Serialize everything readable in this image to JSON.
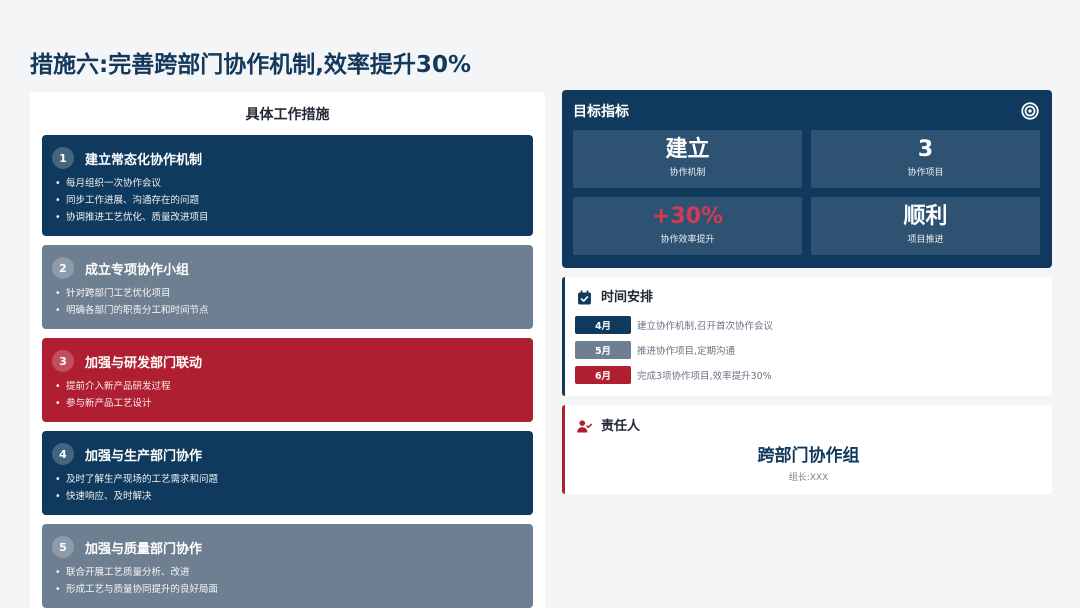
{
  "title": "措施六:完善跨部门协作机制,效率提升30%",
  "colors": {
    "page_background": "#f4f5f7",
    "title": "#12395b",
    "navy": "#0f3a5d",
    "slate": "#6e7f92",
    "crimson": "#af1f31",
    "highlight_red": "#d23b51"
  },
  "measures": {
    "heading": "具体工作措施",
    "items": [
      {
        "num": "1",
        "title": "建立常态化协作机制",
        "color": "#0f3a5d",
        "bullets": [
          "每月组织一次协作会议",
          "同步工作进展、沟通存在的问题",
          "协调推进工艺优化、质量改进项目"
        ]
      },
      {
        "num": "2",
        "title": "成立专项协作小组",
        "color": "#6e7f92",
        "bullets": [
          "针对跨部门工艺优化项目",
          "明确各部门的职责分工和时间节点"
        ]
      },
      {
        "num": "3",
        "title": "加强与研发部门联动",
        "color": "#af1f31",
        "bullets": [
          "提前介入新产品研发过程",
          "参与新产品工艺设计"
        ]
      },
      {
        "num": "4",
        "title": "加强与生产部门协作",
        "color": "#0f3a5d",
        "bullets": [
          "及时了解生产现场的工艺需求和问题",
          "快速响应、及时解决"
        ]
      },
      {
        "num": "5",
        "title": "加强与质量部门协作",
        "color": "#6e7f92",
        "bullets": [
          "联合开展工艺质量分析、改进",
          "形成工艺与质量协同提升的良好局面"
        ]
      }
    ]
  },
  "targets": {
    "heading": "目标指标",
    "icon": "target-icon",
    "tiles": [
      {
        "value": "建立",
        "label": "协作机制",
        "value_color": "#ffffff"
      },
      {
        "value": "3",
        "label": "协作项目",
        "value_color": "#ffffff"
      },
      {
        "value": "+30%",
        "label": "协作效率提升",
        "value_color": "#d23b51"
      },
      {
        "value": "顺利",
        "label": "项目推进",
        "value_color": "#ffffff"
      }
    ]
  },
  "schedule": {
    "heading": "时间安排",
    "icon": "calendar-check-icon",
    "rows": [
      {
        "month": "4月",
        "text": "建立协作机制,召开首次协作会议",
        "color": "#0f3a5d"
      },
      {
        "month": "5月",
        "text": "推进协作项目,定期沟通",
        "color": "#6e7f92"
      },
      {
        "month": "6月",
        "text": "完成3项协作项目,效率提升30%",
        "color": "#af1f31"
      }
    ]
  },
  "owner": {
    "heading": "责任人",
    "icon": "user-check-icon",
    "name": "跨部门协作组",
    "lead": "组长:XXX"
  }
}
